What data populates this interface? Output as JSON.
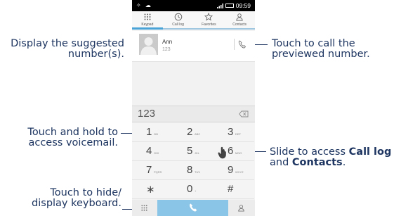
{
  "colors": {
    "annotation_text": "#1d3560",
    "dial_button": "#8ac4e6",
    "tab_indicator": "#4aa3d6"
  },
  "annotations": {
    "suggested_line1": "Display the suggested",
    "suggested_line2": "number(s).",
    "preview_call_line1": "Touch to call the",
    "preview_call_line2": "previewed number.",
    "voicemail_line1": "Touch and hold to",
    "voicemail_line2": "access voicemail.",
    "slide_line1_prefix": "Slide to access ",
    "slide_line1_bold": "Call log",
    "slide_line2_prefix": "and ",
    "slide_line2_bold": "Contacts",
    "slide_line2_suffix": ".",
    "keyboard_line1": "Touch to hide/",
    "keyboard_line2": "display keyboard."
  },
  "status_bar": {
    "time": "09:59"
  },
  "tabs": [
    {
      "label": "Keypad",
      "icon": "keypad-icon"
    },
    {
      "label": "Call log",
      "icon": "clock-icon"
    },
    {
      "label": "Favorites",
      "icon": "star-icon"
    },
    {
      "label": "Contacts",
      "icon": "person-icon"
    }
  ],
  "suggestion": {
    "name": "Ann",
    "number": "123"
  },
  "dialer": {
    "input": "123"
  },
  "keys": [
    {
      "digit": "1",
      "letters": "ΩΩ"
    },
    {
      "digit": "2",
      "letters": "ABC"
    },
    {
      "digit": "3",
      "letters": "DEF"
    },
    {
      "digit": "4",
      "letters": "GHI"
    },
    {
      "digit": "5",
      "letters": "JKL"
    },
    {
      "digit": "6",
      "letters": "MNO"
    },
    {
      "digit": "7",
      "letters": "PQRS"
    },
    {
      "digit": "8",
      "letters": "TUV"
    },
    {
      "digit": "9",
      "letters": "WXYZ"
    },
    {
      "digit": "∗",
      "letters": ""
    },
    {
      "digit": "0",
      "letters": "+"
    },
    {
      "digit": "#",
      "letters": ""
    }
  ]
}
